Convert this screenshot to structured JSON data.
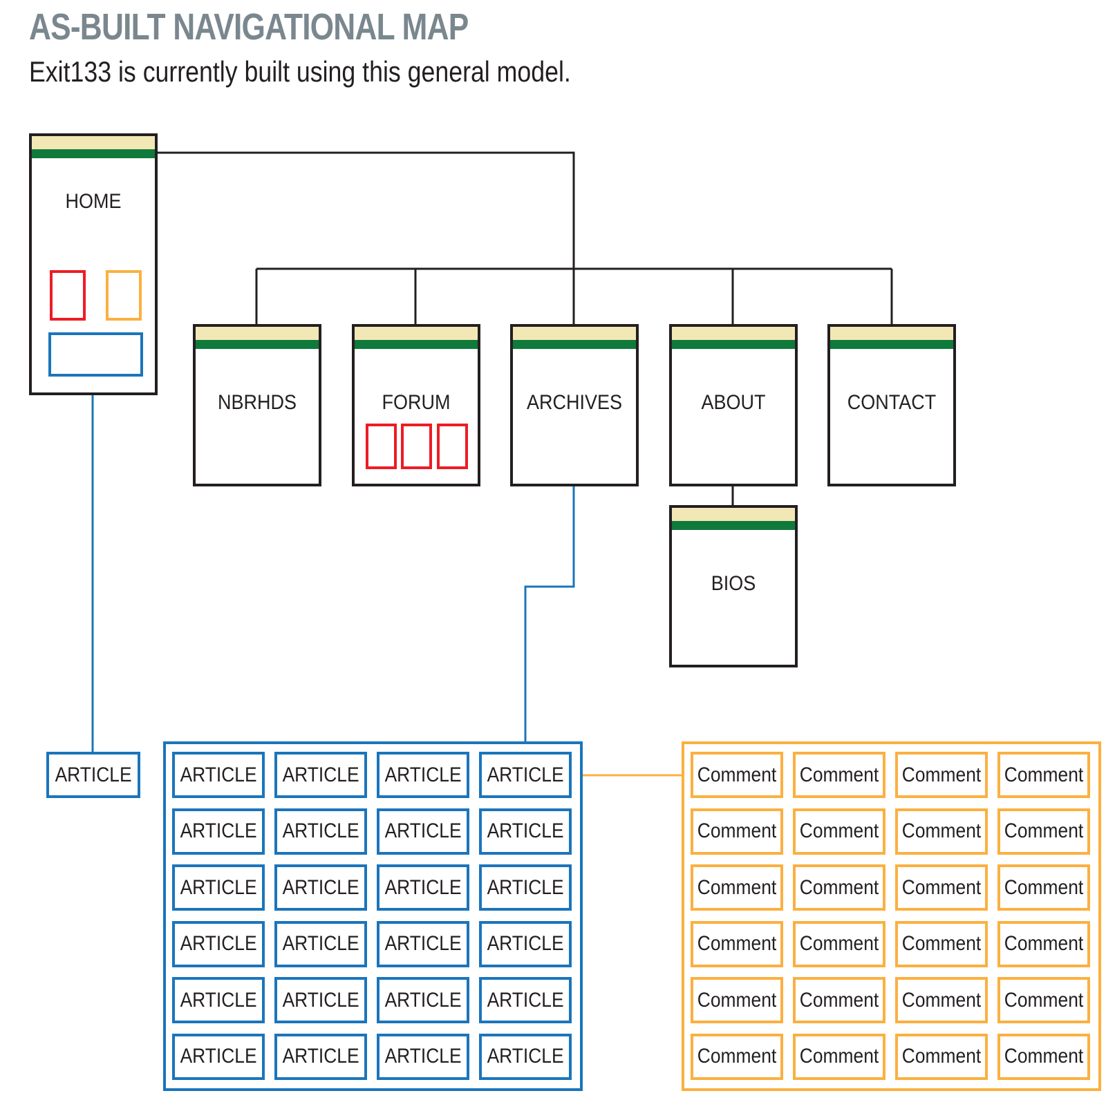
{
  "header": {
    "title": "AS-BUILT NAVIGATIONAL MAP",
    "subtitle": "Exit133 is currently built using this general model."
  },
  "colors": {
    "page_border": "#231f20",
    "page_header_top": "#f2e8b5",
    "page_header_band": "#0f7a3c",
    "forum_red": "#ed1c24",
    "comment_orange": "#fbb040",
    "article_blue": "#1b75bc",
    "title_gray": "#7a878e"
  },
  "pages": {
    "home": "HOME",
    "nbrhds": "NBRHDS",
    "forum": "FORUM",
    "archives": "ARCHIVES",
    "about": "ABOUT",
    "contact": "CONTACT",
    "bios": "BIOS"
  },
  "home_article": "ARTICLE",
  "articles": {
    "label": "ARTICLE",
    "rows": 6,
    "cols": 4
  },
  "comments": {
    "label": "Comment",
    "rows": 6,
    "cols": 4
  }
}
